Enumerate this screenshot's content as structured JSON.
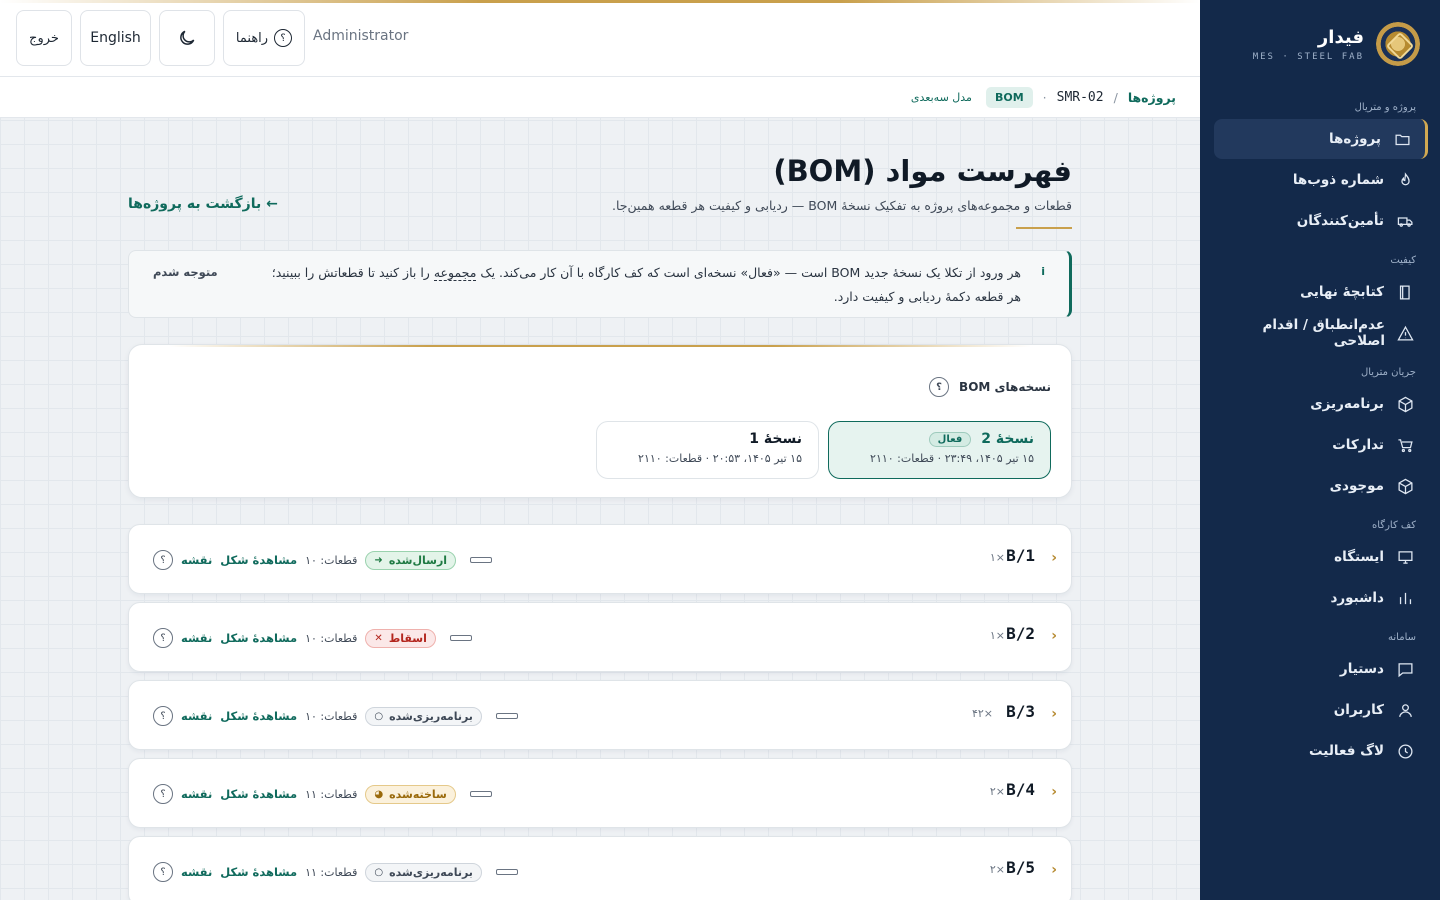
{
  "sidebar": {
    "brand_name": "فیدار",
    "brand_sub": "MES · STEEL FAB",
    "sections": {
      "projects": "پروژه و متریال",
      "quality": "کیفیت",
      "material_flow": "جریان متریال",
      "shop_floor": "کف کارگاه",
      "system": "سامانه"
    },
    "items": {
      "projects": "پروژه‌ها",
      "heat_numbers": "شماره ذوب‌ها",
      "suppliers": "تأمین‌کنندگان",
      "final_dossier": "کتابچهٔ نهایی",
      "ncr": "عدم‌انطباق / اقدام اصلاحی",
      "planning": "برنامه‌ریزی",
      "procurement": "تدارکات",
      "inventory": "موجودی",
      "station": "ایستگاه",
      "dashboard": "داشبورد",
      "assistant": "دستیار",
      "users": "کاربران",
      "activity_log": "لاگ فعالیت"
    }
  },
  "topbar": {
    "exit": "خروج",
    "language": "English",
    "help": "راهنما",
    "help_q": "؟",
    "user": "Administrator"
  },
  "breadcrumb": {
    "projects": "پروژه‌ها",
    "sep": "/",
    "code": "SMR-02",
    "dot": "·",
    "badge": "BOM",
    "model": "مدل سه‌بعدی"
  },
  "page": {
    "title": "فهرست مواد (BOM)",
    "subtitle": "قطعات و مجموعه‌های پروژه به تفکیک نسخهٔ BOM — ردیابی و کیفیت هر قطعه همین‌جا.",
    "back": "← بازگشت به پروژه‌ها"
  },
  "info": {
    "icon": "i",
    "line1_a": "هر ورود از تکلا یک نسخهٔ جدید BOM است — «فعال» نسخه‌ای است که کف کارگاه با آن کار می‌کند. یک ",
    "line1_link": "مجموعه",
    "line1_b": " را باز کنید تا قطعاتش را ببینید؛",
    "line2": "هر قطعه دکمهٔ ردیابی و کیفیت دارد.",
    "dismiss": "متوجه شدم"
  },
  "versions": {
    "heading": "نسخه‌های BOM",
    "q": "؟",
    "items": [
      {
        "name": "نسخهٔ 2",
        "badge": "فعال",
        "meta": "۱۵ تیر ۱۴۰۵، ۲۳:۴۹ · قطعات: ۲۱۱۰"
      },
      {
        "name": "نسخهٔ 1",
        "badge": "",
        "meta": "۱۵ تیر ۱۴۰۵، ۲۰:۵۳ · قطعات: ۲۱۱۰"
      }
    ]
  },
  "rows": [
    {
      "name": "B/1",
      "qty": "×۱",
      "status": "ارسال‌شده",
      "status_icon": "➜",
      "count": "قطعات: ۱۰",
      "view": "مشاهدهٔ شکل",
      "drawing": "نقشه",
      "q": "؟"
    },
    {
      "name": "B/2",
      "qty": "×۱",
      "status": "اسقاط",
      "status_icon": "✕",
      "count": "قطعات: ۱۰",
      "view": "مشاهدهٔ شکل",
      "drawing": "نقشه",
      "q": "؟"
    },
    {
      "name": "B/3",
      "qty": "×۴۲",
      "status": "برنامه‌ریزی‌شده",
      "status_icon": "○",
      "count": "قطعات: ۱۰",
      "view": "مشاهدهٔ شکل",
      "drawing": "نقشه",
      "q": "؟"
    },
    {
      "name": "B/4",
      "qty": "×۲",
      "status": "ساخته‌شده",
      "status_icon": "◕",
      "count": "قطعات: ۱۱",
      "view": "مشاهدهٔ شکل",
      "drawing": "نقشه",
      "q": "؟"
    },
    {
      "name": "B/5",
      "qty": "×۲",
      "status": "برنامه‌ریزی‌شده",
      "status_icon": "○",
      "count": "قطعات: ۱۱",
      "view": "مشاهدهٔ شکل",
      "drawing": "نقشه",
      "q": "؟"
    }
  ],
  "colors": {
    "accent": "#0f6a5c",
    "gold": "#c9a04c",
    "sidebar": "#13294a"
  }
}
